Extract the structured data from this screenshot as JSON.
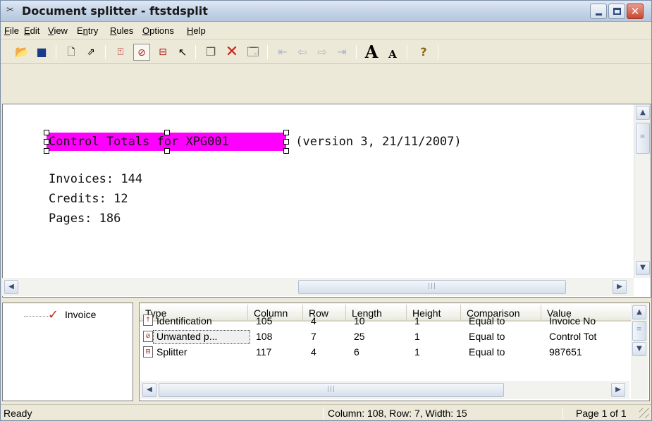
{
  "window": {
    "title": "Document splitter - ftstdsplit",
    "minimize_icon": "minimize-icon",
    "maximize_icon": "maximize-icon",
    "close_icon": "close-icon"
  },
  "menu": [
    {
      "pre": "",
      "acc": "F",
      "post": "ile"
    },
    {
      "pre": "",
      "acc": "E",
      "post": "dit"
    },
    {
      "pre": "",
      "acc": "V",
      "post": "iew"
    },
    {
      "pre": "E",
      "acc": "n",
      "post": "try"
    },
    {
      "pre": "",
      "acc": "R",
      "post": "ules"
    },
    {
      "pre": "",
      "acc": "O",
      "post": "ptions"
    },
    {
      "pre": "",
      "acc": "H",
      "post": "elp"
    }
  ],
  "toolbar": {
    "icons": [
      "open-folder-icon",
      "save-icon",
      "entry-e-icon",
      "entry-arrow-icon",
      "identification-icon",
      "unwanted-page-icon",
      "splitter-icon",
      "pointer-icon",
      "copy-icon",
      "delete-icon",
      "properties-icon",
      "first-page-icon",
      "previous-page-icon",
      "next-page-icon",
      "last-page-icon",
      "increase-font-icon",
      "decrease-font-icon",
      "help-icon"
    ],
    "font_larger": "A",
    "font_smaller": "A",
    "help": "?"
  },
  "document": {
    "line1_highlight": "Control Totals for XPG001",
    "line1_rest": " (version 3, 21/11/2007)",
    "line2": "Invoices: 144",
    "line3": "Credits: 12",
    "line4": "Pages: 186",
    "highlight_color": "#ff00ff"
  },
  "tree": {
    "item_label": "Invoice",
    "item_icon": "checkmark-icon"
  },
  "rules_table": {
    "columns": [
      "Type",
      "Column",
      "Row",
      "Length",
      "Height",
      "Comparison",
      "Value"
    ],
    "rows": [
      {
        "icon": "identification-icon",
        "type": "Identification",
        "column": "105",
        "row": "4",
        "length": "10",
        "height": "1",
        "comparison": "Equal to",
        "value": "Invoice No"
      },
      {
        "icon": "unwanted-page-icon",
        "type": "Unwanted p...",
        "column": "108",
        "row": "7",
        "length": "25",
        "height": "1",
        "comparison": "Equal to",
        "value": "Control Tot"
      },
      {
        "icon": "splitter-icon",
        "type": "Splitter",
        "column": "117",
        "row": "4",
        "length": "6",
        "height": "1",
        "comparison": "Equal to",
        "value": "987651"
      }
    ]
  },
  "status": {
    "ready": "Ready",
    "position": "Column: 108, Row: 7, Width: 15",
    "page": "Page 1 of 1"
  }
}
